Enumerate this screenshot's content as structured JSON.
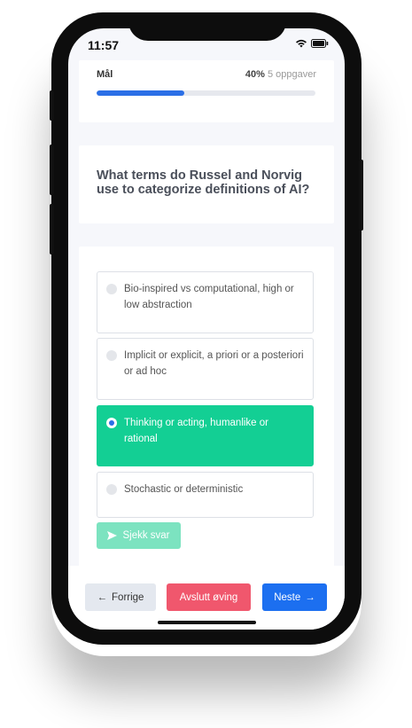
{
  "status": {
    "time": "11:57"
  },
  "goal": {
    "label": "Mål",
    "percent_text": "40%",
    "tasks_text": "5 oppgaver",
    "progress": 0.4
  },
  "question": {
    "text": "What terms do Russel and Norvig use to categorize definitions of AI?"
  },
  "options": [
    {
      "text": "Bio-inspired vs computational, high or low abstraction",
      "selected": false
    },
    {
      "text": "Implicit or explicit, a priori or a posteriori or ad hoc",
      "selected": false
    },
    {
      "text": "Thinking or acting, humanlike or rational",
      "selected": true
    },
    {
      "text": "Stochastic or deterministic",
      "selected": false
    }
  ],
  "check_button": {
    "label": "Sjekk svar",
    "icon": "send-icon"
  },
  "bottom_nav": {
    "prev_label": "Forrige",
    "quit_label": "Avslutt øving",
    "next_label": "Neste"
  },
  "colors": {
    "accent_blue": "#2b6fe6",
    "selected_green": "#13cf94",
    "check_green": "#7ce3c0",
    "quit_red": "#f0576d",
    "next_blue": "#1c6ff0"
  }
}
